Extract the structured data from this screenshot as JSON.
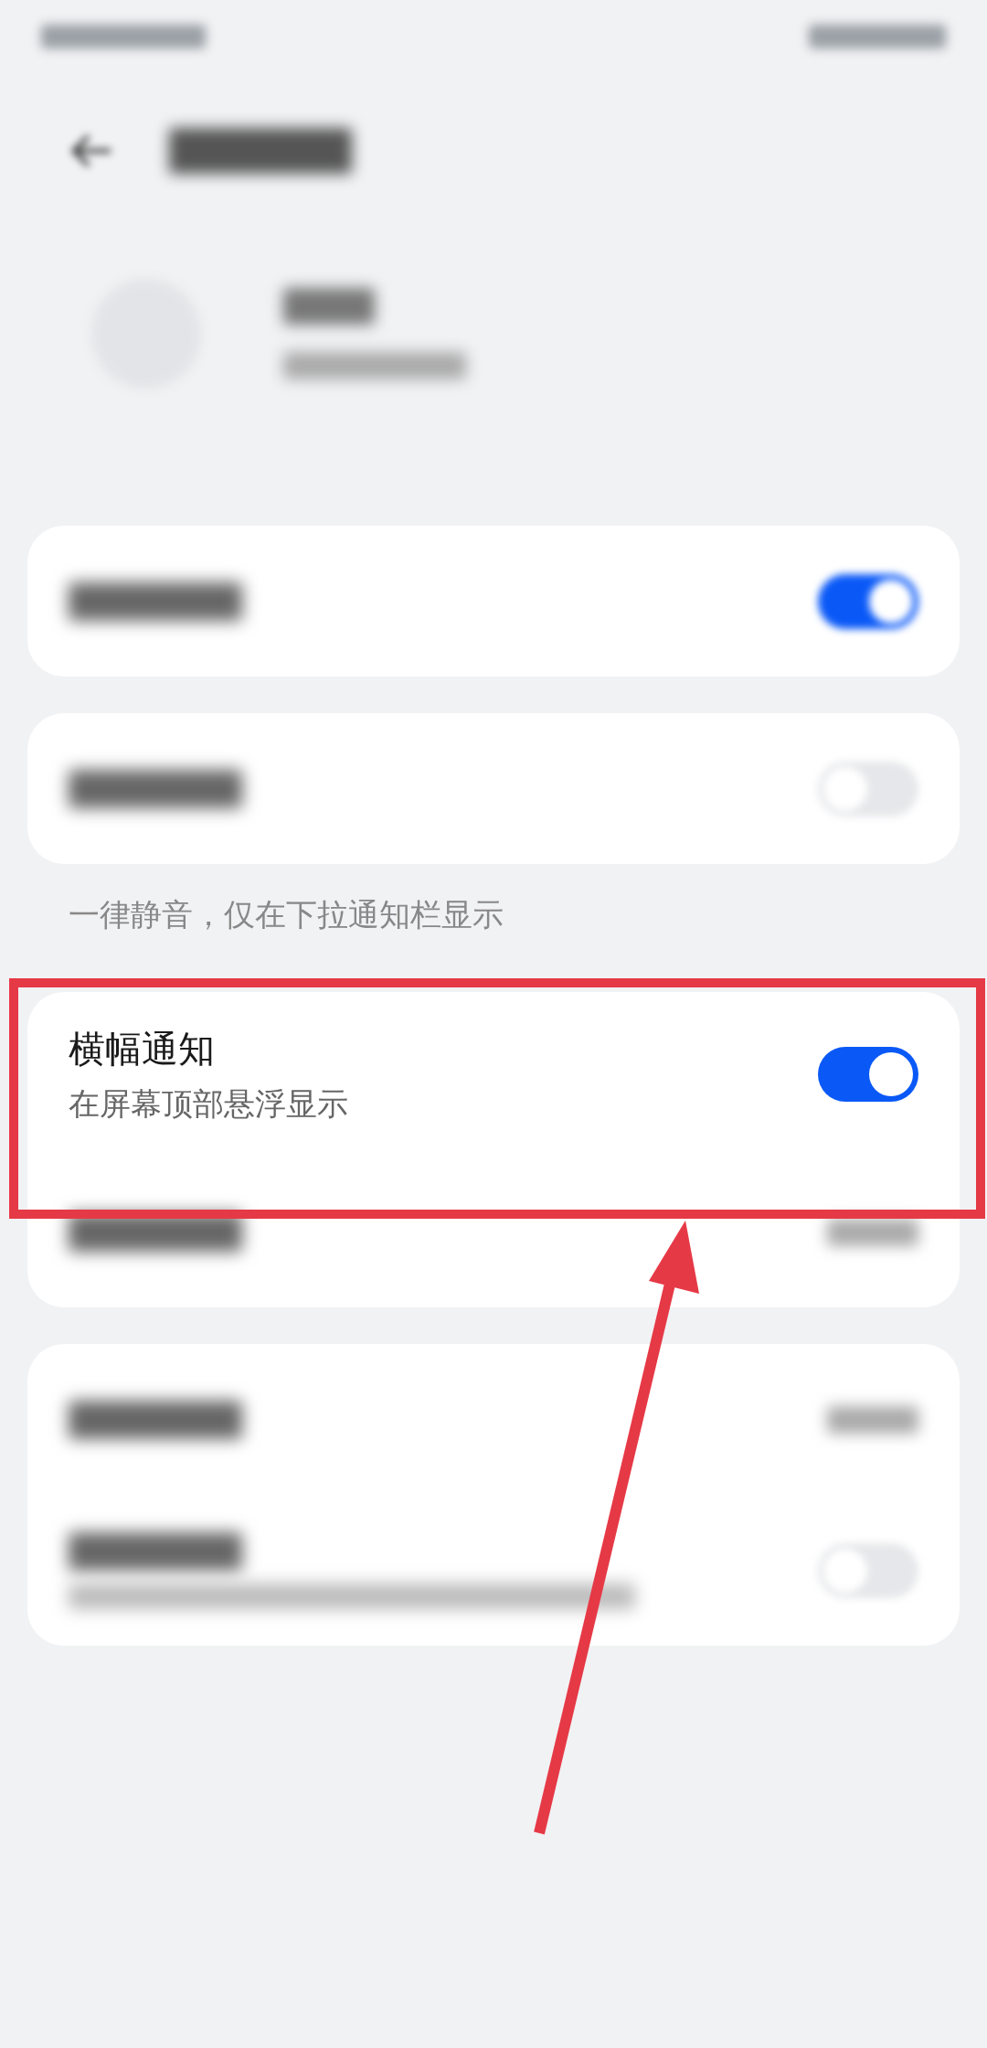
{
  "sections": [
    {
      "rows": [
        {
          "kind": "toggle",
          "on": true
        }
      ]
    },
    {
      "rows": [
        {
          "kind": "toggle",
          "on": false
        }
      ],
      "footer": "一律静音，仅在下拉通知栏显示"
    },
    {
      "rows": [
        {
          "kind": "toggle",
          "title": "横幅通知",
          "subtitle": "在屏幕顶部悬浮显示",
          "on": true
        },
        {
          "kind": "value"
        }
      ]
    },
    {
      "rows": [
        {
          "kind": "value"
        },
        {
          "kind": "toggle",
          "on": false,
          "two_line": true
        }
      ]
    }
  ]
}
